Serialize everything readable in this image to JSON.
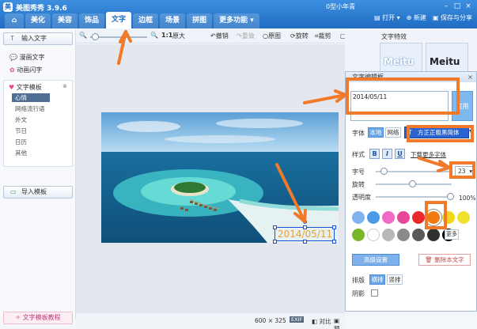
{
  "app": {
    "title": "美图秀秀 3.9.6",
    "logo": "picture-logo-icon"
  },
  "titlebar": {
    "user": "0型小年青",
    "minimize": "–",
    "maximize": "□",
    "close": "×"
  },
  "tabs": [
    {
      "label": ""
    },
    {
      "label": "美化"
    },
    {
      "label": "美容"
    },
    {
      "label": "饰品"
    },
    {
      "label": "文字"
    },
    {
      "label": "边框"
    },
    {
      "label": "场景"
    },
    {
      "label": "拼图"
    },
    {
      "label": "更多功能 ▾"
    }
  ],
  "top_actions": {
    "open": "打开 ▾",
    "new": "新建",
    "save": "保存与分享"
  },
  "toolbar": {
    "zoom_100": "1:1",
    "original_size": "原大",
    "undo": "撤销",
    "redo": "重做",
    "original": "原图",
    "rotate": "旋转",
    "crop": "裁剪",
    "size": "尺寸"
  },
  "sidebar": {
    "input_text": "输入文字",
    "comic_text": "漫画文字",
    "animated_text": "动画闪字",
    "templates": "文字模板",
    "template_items": [
      "心情",
      "网络流行语",
      "外文",
      "节日",
      "日历",
      "其他"
    ],
    "selected_template": "心情",
    "import_template": "导入模板",
    "tutorial": "文字模板教程"
  },
  "canvas": {
    "overlay_text": "2014/05/11"
  },
  "statusbar": {
    "dimensions": "600 × 325",
    "exif": "EXIF",
    "compare": "对比",
    "preview": "预览"
  },
  "effects": {
    "title": "文字特效",
    "cards": [
      "Meitu",
      "Meitu"
    ]
  },
  "dialog": {
    "title": "文字编辑框",
    "close": "×",
    "text_value": "2014/05/11",
    "apply": "应用",
    "font_label": "字体",
    "font_local": "本地",
    "font_online": "网络",
    "font_selected": "方正正粗黑简体",
    "style_label": "样式",
    "bold": "B",
    "italic": "I",
    "underline": "U",
    "download_more": "下载更多字体",
    "size_label": "字号",
    "size_value": "23",
    "rotate_label": "旋转",
    "opacity_label": "透明度",
    "opacity_value": "100%",
    "more_colors": "更多",
    "advanced": "高级设置",
    "delete": "删除本文字",
    "layout_label": "排版",
    "horizontal": "横排",
    "vertical": "竖排",
    "shadow_label": "阴影",
    "colors": [
      "#7fb4f0",
      "#4a9ae8",
      "#f06ac8",
      "#e84898",
      "#e82a2a",
      "#f07a10",
      "#f0d818",
      "#f0e030",
      "#78b828",
      "#ffffff",
      "#b8b8b8",
      "#8a8a8a",
      "#5a5a5a",
      "#303030",
      "#000000"
    ],
    "selected_color": "#f07a10"
  },
  "annotations": {
    "color": "#f07a2a"
  }
}
